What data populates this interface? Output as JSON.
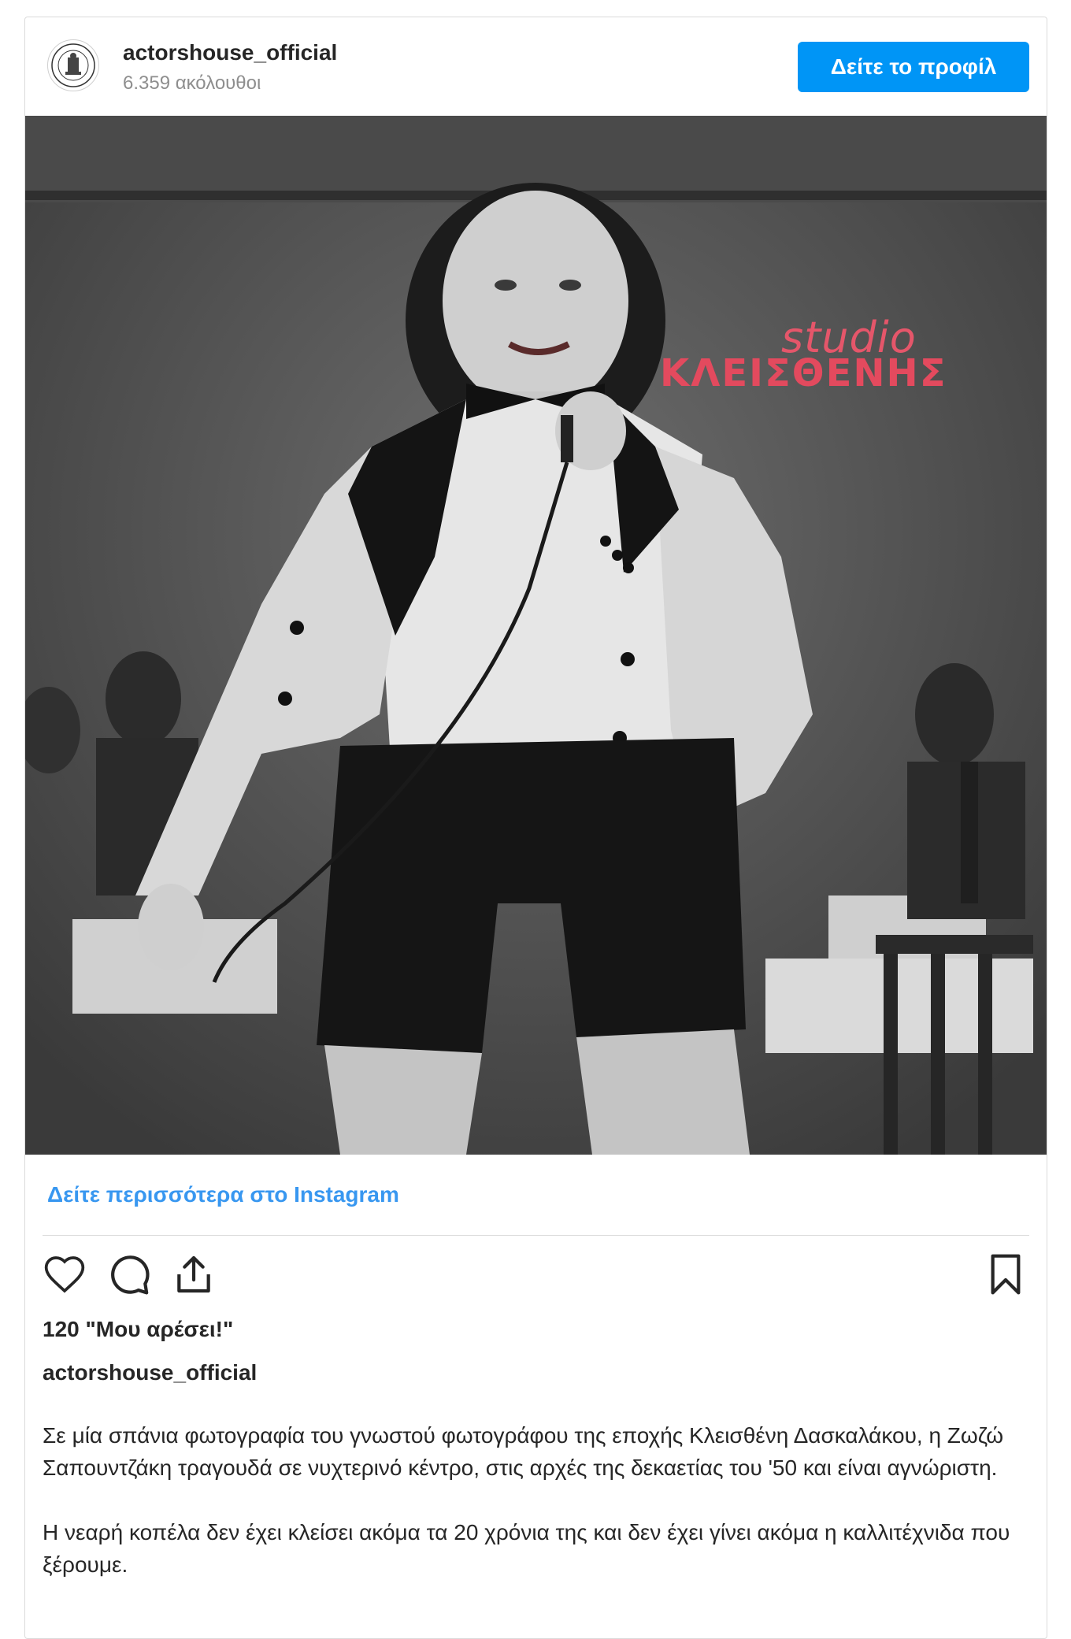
{
  "post": {
    "username": "actorshouse_official",
    "followers": "6.359 ακόλουθοι",
    "profile_button": "Δείτε το προφίλ",
    "more_link": "Δείτε περισσότερα στο Instagram",
    "likes": "120 \"Μου αρέσει!\"",
    "caption_user": "actorshouse_official",
    "caption_p1": "Σε μία σπάνια φωτογραφία του γνωστού φωτογράφου της εποχής Κλεισθένη Δασκαλάκου, η Ζωζώ Σαπουντζάκη τραγουδά σε νυχτερινό κέντρο, στις αρχές της δεκαετίας του '50 και είναι αγνώριστη.",
    "caption_p2": "Η νεαρή κοπέλα δεν έχει κλείσει ακόμα τα 20 χρόνια της και δεν έχει γίνει ακόμα η καλλιτέχνιδα που ξέρουμε."
  },
  "photo": {
    "watermark_line1": "studio",
    "watermark_line2": "ΚΛΕΙΣΘΕΝΗΣ",
    "watermark_color": "#e34a5e"
  },
  "icons": {
    "like": "heart-icon",
    "comment": "comment-icon",
    "share": "share-icon",
    "save": "bookmark-icon"
  },
  "colors": {
    "accent": "#0095f6",
    "link": "#3897f0",
    "text": "#262626",
    "muted": "#8e8e8e"
  }
}
